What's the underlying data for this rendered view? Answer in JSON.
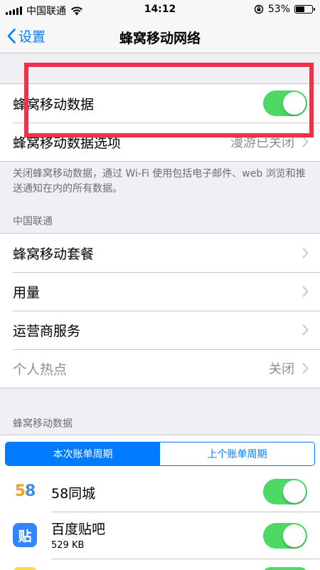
{
  "status": {
    "carrier": "中国联通",
    "time": "14:12",
    "battery": "53%",
    "battery_level": 0.53
  },
  "nav": {
    "back_label": "设置",
    "title": "蜂窝移动网络"
  },
  "cellular_data": {
    "label": "蜂窝移动数据",
    "enabled": true
  },
  "cellular_options": {
    "label": "蜂窝移动数据选项",
    "value": "漫游已关闭"
  },
  "footer_note": "关闭蜂窝移动数据，通过 Wi-Fi 使用包括电子邮件、web 浏览和推送通知在内的所有数据。",
  "carrier_section": {
    "header": "中国联通",
    "items": [
      {
        "label": "蜂窝移动套餐"
      },
      {
        "label": "用量"
      },
      {
        "label": "运营商服务"
      },
      {
        "label": "个人热点",
        "value": "关闭"
      }
    ]
  },
  "usage_section": {
    "header": "蜂窝移动数据",
    "segments": [
      "本次账单周期",
      "上个账单周期"
    ],
    "selected_segment": 0
  },
  "apps": [
    {
      "name": "58同城",
      "icon": "58",
      "size": "",
      "enabled": true
    },
    {
      "name": "百度贴吧",
      "icon": "贴",
      "size": "529 KB",
      "enabled": true
    }
  ],
  "colors": {
    "accent": "#007aff",
    "toggle_on": "#4cd964",
    "highlight_box": "#f0314a"
  }
}
